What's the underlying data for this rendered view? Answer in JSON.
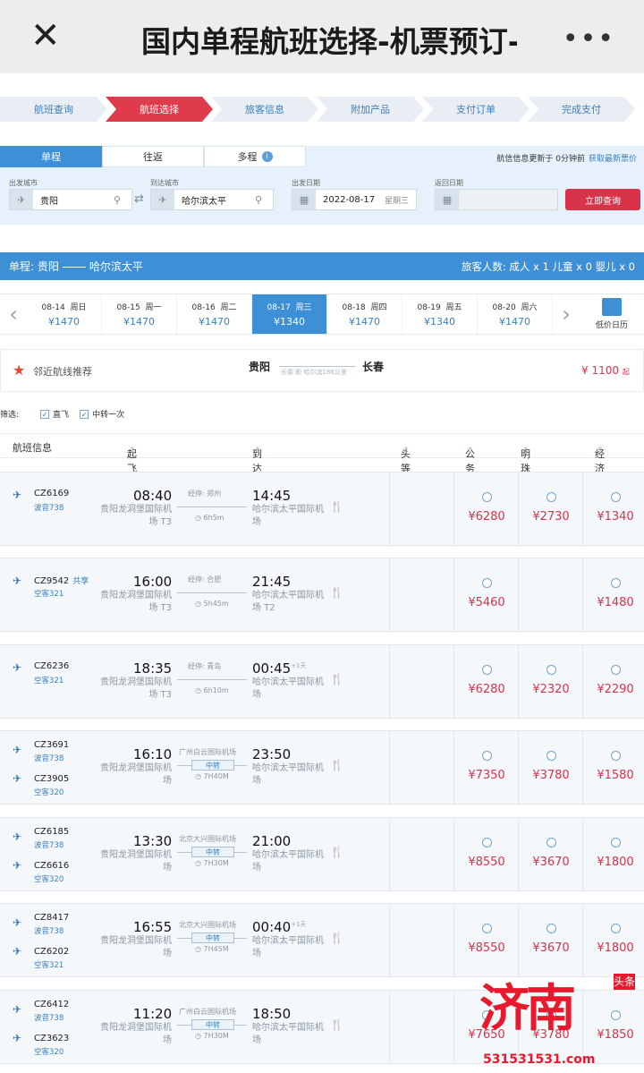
{
  "header": {
    "close": "✕",
    "title": "国内单程航班选择-机票预订-",
    "more": "•••"
  },
  "steps": [
    "航班查询",
    "航班选择",
    "旅客信息",
    "附加产品",
    "支付订单",
    "完成支付"
  ],
  "trip_tabs": [
    "单程",
    "往返",
    "多程"
  ],
  "update_text": "航信信息更新于 0分钟前",
  "update_link": "获取最新票价",
  "search": {
    "from_label": "出发城市",
    "from_value": "贵阳",
    "to_label": "到达城市",
    "to_value": "哈尔滨太平",
    "date_label": "出发日期",
    "date_value": "2022-08-17",
    "date_weekday": "星期三",
    "return_label": "返回日期",
    "query_button": "立即查询"
  },
  "route_bar": {
    "prefix": "单程:",
    "from": "贵阳",
    "to": "哈尔滨太平",
    "passengers": "旅客人数: 成人 x 1 儿童 x 0 婴儿 x 0"
  },
  "dates": [
    {
      "d": "08-14",
      "w": "周日",
      "p": "¥1470"
    },
    {
      "d": "08-15",
      "w": "周一",
      "p": "¥1470"
    },
    {
      "d": "08-16",
      "w": "周二",
      "p": "¥1470"
    },
    {
      "d": "08-17",
      "w": "周三",
      "p": "¥1340"
    },
    {
      "d": "08-18",
      "w": "周四",
      "p": "¥1470"
    },
    {
      "d": "08-19",
      "w": "周五",
      "p": "¥1340"
    },
    {
      "d": "08-20",
      "w": "周六",
      "p": "¥1470"
    }
  ],
  "calendar_label": "低价日历",
  "nearby": {
    "label": "邻近航线推荐",
    "from": "贵阳",
    "to": "长春",
    "note": "长春 距 哈尔滨186公里",
    "price": "¥ 1100",
    "price_suffix": "起"
  },
  "filter": {
    "label": "筛选:",
    "opt1": "直飞",
    "opt2": "中转一次"
  },
  "columns": {
    "info": "航班信息",
    "dep": "起飞时间",
    "arr": "到达时间",
    "first": "头等舱",
    "business": "公务舱",
    "premium": "明珠经济舱",
    "economy": "经济舱"
  },
  "flights": [
    {
      "code1": "CZ6169",
      "plane1": "波音738",
      "dep": "08:40",
      "dep_ap": "贵阳龙洞堡国际机场 T3",
      "stop": "经停: 郑州",
      "dur": "6h5m",
      "arr": "14:45",
      "arr_ap": "哈尔滨太平国际机场",
      "biz": "¥6280",
      "prem": "¥2730",
      "eco": "¥1340"
    },
    {
      "code1": "CZ9542",
      "share": "共享",
      "plane1": "空客321",
      "dep": "16:00",
      "dep_ap": "贵阳龙洞堡国际机场 T3",
      "stop": "经停: 合肥",
      "dur": "5h45m",
      "arr": "21:45",
      "arr_ap": "哈尔滨太平国际机场 T2",
      "biz": "¥5460",
      "eco": "¥1480"
    },
    {
      "code1": "CZ6236",
      "plane1": "空客321",
      "dep": "18:35",
      "dep_ap": "贵阳龙洞堡国际机场 T3",
      "stop": "经停: 青岛",
      "dur": "6h10m",
      "arr": "00:45",
      "plus": "+1天",
      "arr_ap": "哈尔滨太平国际机场",
      "biz": "¥6280",
      "prem": "¥2320",
      "eco": "¥2290"
    },
    {
      "code1": "CZ3691",
      "plane1": "波音738",
      "code2": "CZ3905",
      "plane2": "空客320",
      "dep": "16:10",
      "dep_ap": "贵阳龙洞堡国际机场",
      "stop": "广州白云国际机场",
      "transfer": "中转",
      "dur": "7H40M",
      "arr": "23:50",
      "arr_ap": "哈尔滨太平国际机场",
      "biz": "¥7350",
      "prem": "¥3780",
      "eco": "¥1580"
    },
    {
      "code1": "CZ6185",
      "plane1": "波音738",
      "code2": "CZ6616",
      "plane2": "空客320",
      "dep": "13:30",
      "dep_ap": "贵阳龙洞堡国际机场",
      "stop": "北京大兴国际机场",
      "transfer": "中转",
      "dur": "7H30M",
      "arr": "21:00",
      "arr_ap": "哈尔滨太平国际机场",
      "biz": "¥8550",
      "prem": "¥3670",
      "eco": "¥1800"
    },
    {
      "code1": "CZ8417",
      "plane1": "波音738",
      "code2": "CZ6202",
      "plane2": "空客321",
      "dep": "16:55",
      "dep_ap": "贵阳龙洞堡国际机场",
      "stop": "北京大兴国际机场",
      "transfer": "中转",
      "dur": "7H45M",
      "arr": "00:40",
      "plus": "+1天",
      "arr_ap": "哈尔滨太平国际机场",
      "biz": "¥8550",
      "prem": "¥3670",
      "eco": "¥1800"
    },
    {
      "code1": "CZ6412",
      "plane1": "波音738",
      "code2": "CZ3623",
      "plane2": "空客320",
      "dep": "11:20",
      "dep_ap": "贵阳龙洞堡国际机场",
      "stop": "广州白云国际机场",
      "transfer": "中转",
      "dur": "7H30M",
      "arr": "18:50",
      "arr_ap": "哈尔滨太平国际机场",
      "biz": "¥7650",
      "prem": "¥3780",
      "eco": "¥1850"
    }
  ],
  "watermark": {
    "brand": "济南",
    "tag": "头条",
    "num": "531531531.com"
  }
}
